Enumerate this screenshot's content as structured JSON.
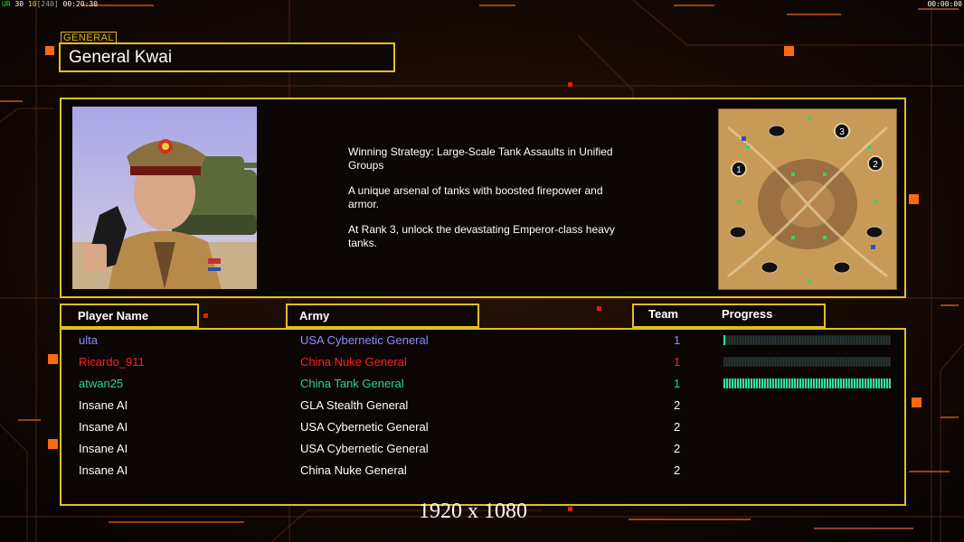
{
  "hud": {
    "fps_label": "UR",
    "fps_value": "30",
    "fps_limit": "10",
    "fps_extra": "[240]",
    "clock_left": "00:20:30",
    "clock_right": "00:00:00"
  },
  "header": {
    "section_tag": "GENERAL",
    "general_name": "General Kwai"
  },
  "info": {
    "strategy_lines": [
      "Winning Strategy: Large-Scale Tank Assaults in Unified\n Groups",
      "A unique arsenal of tanks with boosted firepower and\n armor.",
      "At Rank 3, unlock the devastating Emperor-class heavy\n tanks."
    ],
    "minimap_markers": [
      "1",
      "2",
      "3"
    ]
  },
  "columns": {
    "player": "Player Name",
    "army": "Army",
    "team": "Team",
    "progress": "Progress"
  },
  "players": [
    {
      "name": "ulta",
      "army": "USA Cybernetic General",
      "team": "1",
      "color": "#8c8cff",
      "progress": 0.01
    },
    {
      "name": "Ricardo_911",
      "army": "China Nuke General",
      "team": "1",
      "color": "#ff2020",
      "progress": 0.0
    },
    {
      "name": "atwan25",
      "army": "China Tank General",
      "team": "1",
      "color": "#28d890",
      "progress": 1.0
    },
    {
      "name": "Insane AI",
      "army": "GLA Stealth General",
      "team": "2",
      "color": "#ffffff",
      "progress": null
    },
    {
      "name": "Insane AI",
      "army": "USA Cybernetic General",
      "team": "2",
      "color": "#ffffff",
      "progress": null
    },
    {
      "name": "Insane AI",
      "army": "USA Cybernetic General",
      "team": "2",
      "color": "#ffffff",
      "progress": null
    },
    {
      "name": "Insane AI",
      "army": "China Nuke General",
      "team": "2",
      "color": "#ffffff",
      "progress": null
    }
  ],
  "footer": {
    "resolution_label": "1920 x 1080"
  },
  "colors": {
    "frame_gold": "#e0c020",
    "accent_orange": "#ff6a10",
    "progress_green": "#30e0a0"
  }
}
